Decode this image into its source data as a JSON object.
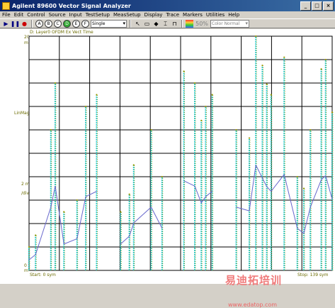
{
  "window": {
    "title": "Agilent 89600 Vector Signal Analyzer"
  },
  "menu": [
    "File",
    "Edit",
    "Control",
    "Source",
    "Input",
    "TestSetup",
    "MeasSetup",
    "Display",
    "Trace",
    "Markers",
    "Utilities",
    "Help"
  ],
  "toolbar": {
    "play_icon": "play-icon",
    "pause_icon": "pause-icon",
    "stop_icon": "record-icon",
    "mode_select": "Single",
    "trace_buttons": [
      "A",
      "B",
      "C",
      "D",
      "E",
      "F"
    ],
    "zoom_value": "50%",
    "color_select": "Color Normal"
  },
  "plot": {
    "trace_title": "D: Layer0 OFDM Ex Vect Time",
    "top_value": "20",
    "top_unit": "m",
    "y_format": "LinMag",
    "per_div_top": "2 m",
    "per_div_label": "/div",
    "bottom_value": "0",
    "bottom_unit": "m",
    "start_label": "Start: 0 sym",
    "stop_label": "Stop: 139 sym"
  },
  "watermark": {
    "text": "易迪拓培训",
    "url": "www.edatop.com"
  },
  "colors": {
    "grid": "#000000",
    "trace_cyan": "#33cccc",
    "trace_olive": "#999900",
    "trace_blue": "#6666cc",
    "label_olive": "#6b6b00"
  },
  "chart_data": {
    "type": "line",
    "xlabel": "",
    "ylabel": "LinMag",
    "x_range": [
      0,
      139
    ],
    "ylim": [
      0,
      20
    ],
    "x": [
      0,
      3,
      10,
      12,
      16,
      22,
      26,
      31,
      42,
      46,
      48,
      56,
      61,
      71,
      76,
      79,
      81,
      84,
      95,
      101,
      104,
      107,
      109,
      111,
      117,
      123,
      126,
      129,
      134,
      136,
      139
    ],
    "values": [
      2,
      3,
      12,
      16,
      5,
      6,
      14,
      15,
      5,
      6.5,
      9,
      12,
      8,
      17,
      16,
      12.8,
      14,
      15,
      12,
      11.3,
      20,
      17.5,
      15.9,
      15,
      18.2,
      8,
      7,
      12,
      17.2,
      18,
      13.5
    ]
  }
}
